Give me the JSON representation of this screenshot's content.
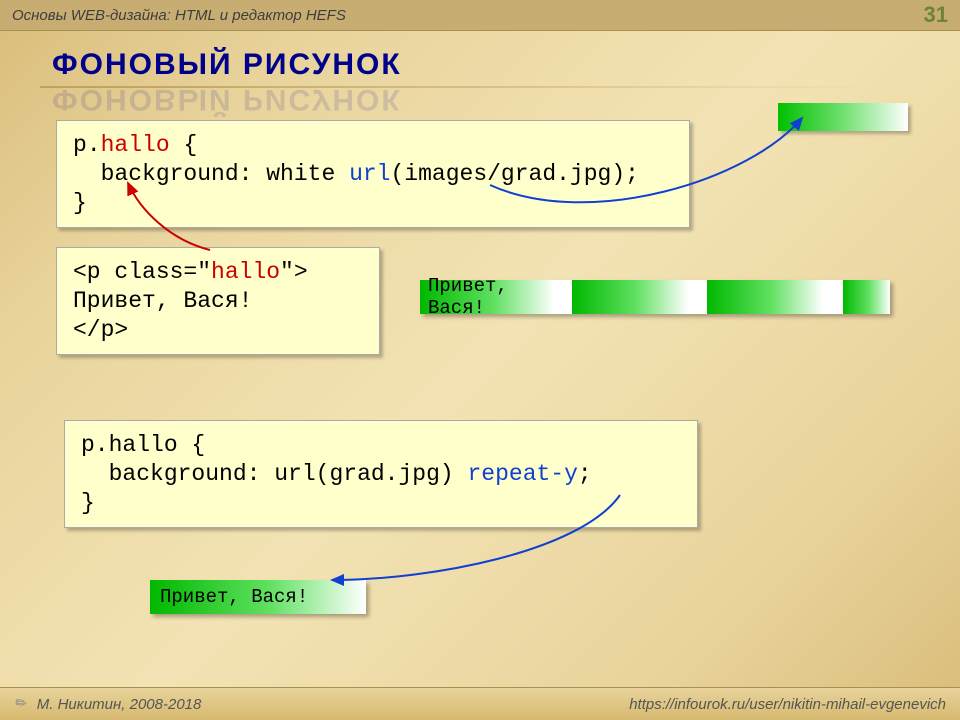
{
  "header": {
    "subject": "Основы WEB-дизайна: HTML и редактор HEFS",
    "page_number": "31"
  },
  "title": "ФОНОВЫЙ РИСУНОК",
  "code1": {
    "sel": "p",
    "dot": ".",
    "cls": "hallo",
    "brace_o": " {",
    "indent": "  ",
    "prop": "background: ",
    "val1": "white ",
    "key": "url",
    "val2": "(images/grad.jpg);",
    "brace_c": "}"
  },
  "code2": {
    "l1_a": "<p class=\"",
    "l1_cls": "hallo",
    "l1_b": "\">",
    "l2": "Привет, Вася!",
    "l3": "</p>"
  },
  "render1": {
    "text": "Привет, Вася!"
  },
  "code3": {
    "l1": "p.hallo {",
    "indent": "  ",
    "prop": "background: ",
    "val1": "url(grad.jpg) ",
    "key": "repeat-y",
    "semi": ";",
    "l3": "}"
  },
  "render2": {
    "text": "Привет, Вася!"
  },
  "footer": {
    "author": "М. Никитин, 2008-2018",
    "url": "https://infourok.ru/user/nikitin-mihail-evgenevich"
  }
}
